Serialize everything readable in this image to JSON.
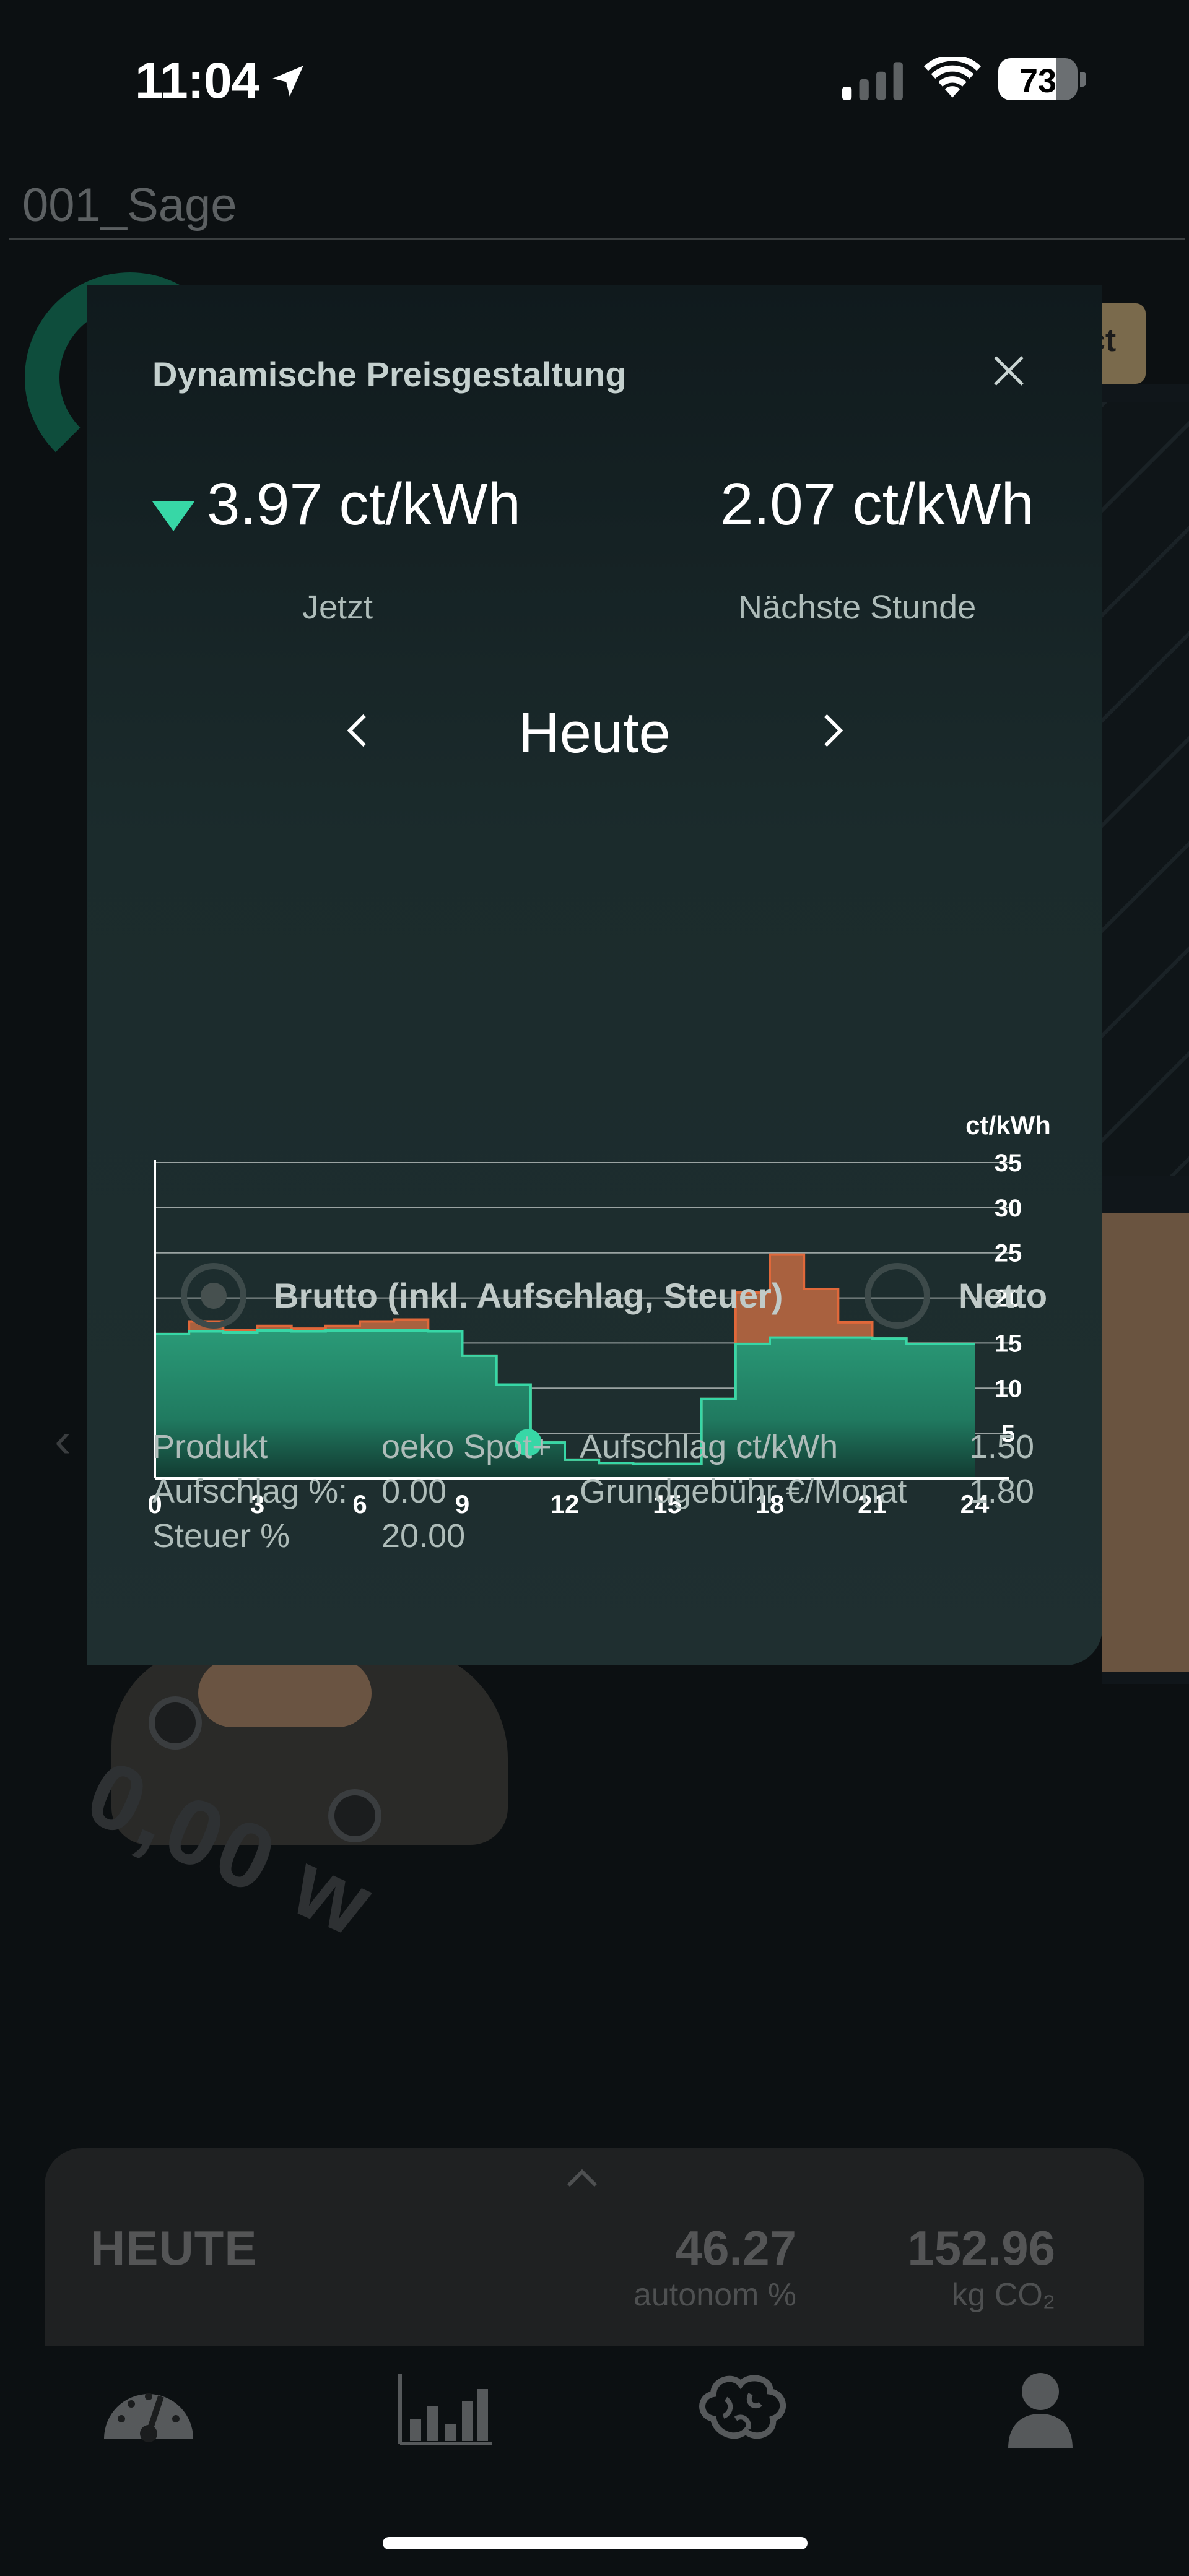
{
  "status_bar": {
    "time": "11:04",
    "battery": "73",
    "battery_level": 73
  },
  "background": {
    "site_name": "001_Sage",
    "tag_text": "ct",
    "car_value": "0,00 w"
  },
  "today_panel": {
    "title": "HEUTE",
    "autonomy_value": "46.27",
    "autonomy_label": "autonom %",
    "co2_value": "152.96",
    "co2_label": "kg CO₂"
  },
  "tab_bar": {
    "items": [
      {
        "icon": "speedometer-icon"
      },
      {
        "icon": "bar-chart-icon"
      },
      {
        "icon": "brain-icon"
      },
      {
        "icon": "person-icon"
      }
    ]
  },
  "modal": {
    "title": "Dynamische Preisgestaltung",
    "price_now": "3.97 ct/kWh",
    "price_now_label": "Jetzt",
    "price_next": "2.07 ct/kWh",
    "price_next_label": "Nächste Stunde",
    "day_label": "Heute",
    "trend": "down",
    "accent_color": "#37d7a6",
    "surcharge_color": "#e0683a",
    "options": {
      "brutto_label": "Brutto (inkl. Aufschlag, Steuer)",
      "netto_label": "Netto",
      "selected": "brutto"
    },
    "info": {
      "product_label": "Produkt",
      "product_value": "oeko Spot+",
      "surcharge_pct_label": "Aufschlag %:",
      "surcharge_pct_value": "0.00",
      "tax_label": "Steuer %",
      "tax_value": "20.00",
      "surcharge_ct_label": "Aufschlag ct/kWh",
      "surcharge_ct_value": "1.50",
      "base_fee_label": "Grundgebühr €/Monat",
      "base_fee_value": "1.80"
    }
  },
  "chart_data": {
    "type": "area",
    "unit_label": "ct/kWh",
    "x_ticks": [
      "0",
      "3",
      "6",
      "9",
      "12",
      "15",
      "18",
      "21",
      "24"
    ],
    "y_ticks": [
      "5",
      "10",
      "15",
      "20",
      "25",
      "30",
      "35"
    ],
    "xlim": [
      0,
      24
    ],
    "ylim": [
      0,
      35
    ],
    "current_hour": 11,
    "current_value": 3.97,
    "series": [
      {
        "name": "Brutto",
        "color": "#e0683a",
        "values": [
          16.0,
          17.4,
          16.4,
          16.9,
          16.6,
          16.9,
          17.4,
          17.6,
          16.3,
          13.6,
          10.4,
          3.97,
          2.07,
          1.7,
          1.6,
          1.6,
          8.8,
          20.6,
          24.8,
          21.0,
          17.3,
          15.5,
          14.9,
          14.9
        ]
      },
      {
        "name": "Netto",
        "color": "#37d7a6",
        "values": [
          16.0,
          16.3,
          16.2,
          16.4,
          16.3,
          16.4,
          16.4,
          16.4,
          16.3,
          13.6,
          10.4,
          3.97,
          2.07,
          1.7,
          1.6,
          1.6,
          8.8,
          14.9,
          15.6,
          15.6,
          15.6,
          15.5,
          14.9,
          14.9
        ]
      }
    ]
  }
}
